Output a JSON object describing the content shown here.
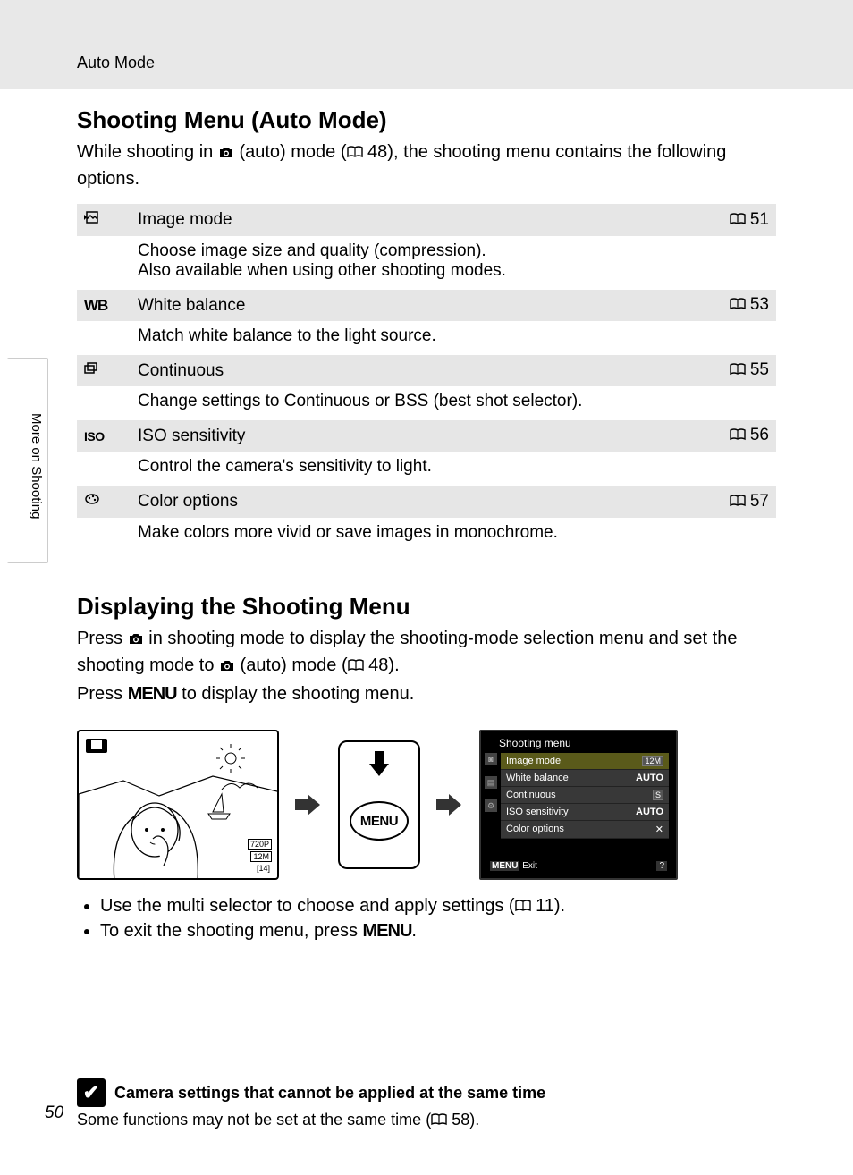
{
  "header": {
    "breadcrumb": "Auto Mode"
  },
  "sideTab": "More on Shooting",
  "pageNumber": "50",
  "section1": {
    "title": "Shooting Menu (Auto Mode)",
    "intro_pre": "While shooting in ",
    "intro_mid": " (auto) mode (",
    "intro_page": " 48), the shooting menu contains the following options.",
    "items": [
      {
        "label": "Image mode",
        "page": "51",
        "desc": "Choose image size and quality (compression).\nAlso available when using other shooting modes."
      },
      {
        "label": "White balance",
        "page": "53",
        "desc": "Match white balance to the light source."
      },
      {
        "label": "Continuous",
        "page": "55",
        "desc": "Change settings to Continuous or BSS (best shot selector)."
      },
      {
        "label": "ISO sensitivity",
        "page": "56",
        "desc": "Control the camera's sensitivity to light."
      },
      {
        "label": "Color options",
        "page": "57",
        "desc": "Make colors more vivid or save images in monochrome."
      }
    ]
  },
  "section2": {
    "title": "Displaying the Shooting Menu",
    "p1a": "Press ",
    "p1b": " in shooting mode to display the shooting-mode selection menu and set the shooting mode to ",
    "p1c": " (auto) mode (",
    "p1d": " 48).",
    "p2a": "Press ",
    "p2b": " to display the shooting menu.",
    "menuButtonLabel": "MENU",
    "menuWord": "MENU",
    "bullets": [
      {
        "pre": "Use the multi selector to choose and apply settings (",
        "page": " 11)."
      },
      {
        "pre": "To exit the shooting menu, press ",
        "menu": "MENU",
        "post": "."
      }
    ]
  },
  "screenMenu": {
    "title": "Shooting menu",
    "rows": [
      {
        "label": "Image mode",
        "value": "12M"
      },
      {
        "label": "White balance",
        "value": "AUTO"
      },
      {
        "label": "Continuous",
        "value": "S"
      },
      {
        "label": "ISO sensitivity",
        "value": "AUTO"
      },
      {
        "label": "Color options",
        "value": "✕"
      }
    ],
    "exit": "Exit",
    "exitBtn": "MENU",
    "help": "?"
  },
  "sceneOverlay": {
    "badge1": "720P",
    "badge2": "12M",
    "badge3": "14"
  },
  "note": {
    "title": "Camera settings that cannot be applied at the same time",
    "body_pre": "Some functions may not be set at the same time (",
    "body_page": " 58)."
  }
}
